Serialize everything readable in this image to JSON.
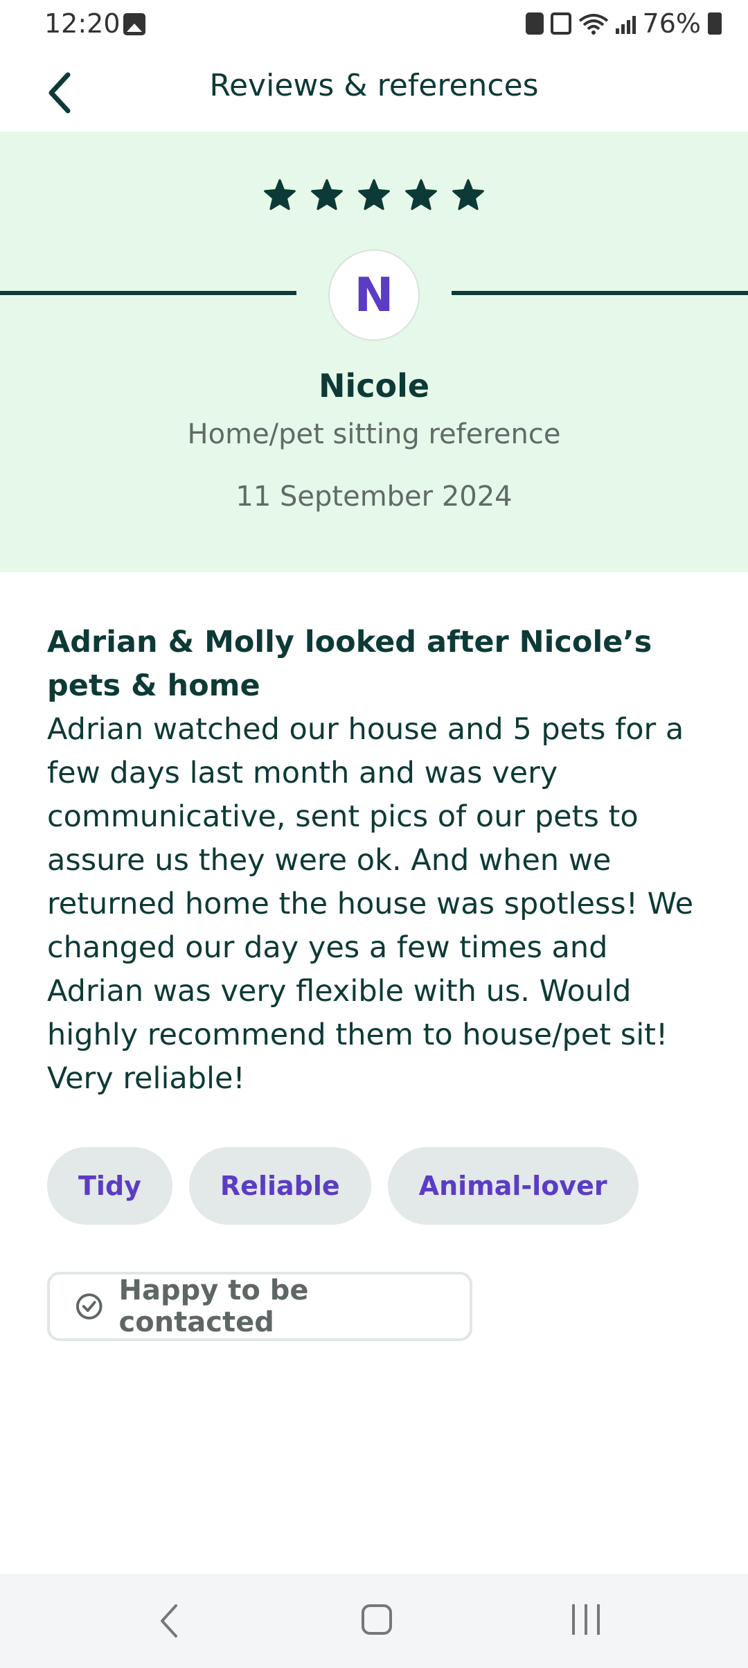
{
  "status_bar": {
    "time": "12:20",
    "battery": "76%",
    "icons": [
      "image-icon",
      "sim-icon",
      "nfc-icon",
      "wifi-icon",
      "signal-icon",
      "battery-icon"
    ]
  },
  "header": {
    "title": "Reviews & references",
    "back_icon": "chevron-left-icon"
  },
  "hero": {
    "rating": 5,
    "avatar_initial": "N",
    "reviewer_name": "Nicole",
    "review_type": "Home/pet sitting reference",
    "date": "11 September 2024"
  },
  "review": {
    "heading": "Adrian & Molly looked after Nicole’s pets & home",
    "text": "Adrian watched our house and 5 pets for a few days last month and was very communicative, sent pics of our pets to assure us they were ok. And when we returned home the house was spotless! We changed our day yes a few times and Adrian was very flexible with us. Would highly recommend them to house/pet sit! Very reliable!"
  },
  "tags": [
    "Tidy",
    "Reliable",
    "Animal-lover"
  ],
  "contact": {
    "label": "Happy to be contacted",
    "icon": "check-circle-icon"
  },
  "colors": {
    "primary": "#0d3a36",
    "accent": "#5b3cc4",
    "hero_bg": "#e6f8e9",
    "tag_bg": "#e3e8e8"
  }
}
